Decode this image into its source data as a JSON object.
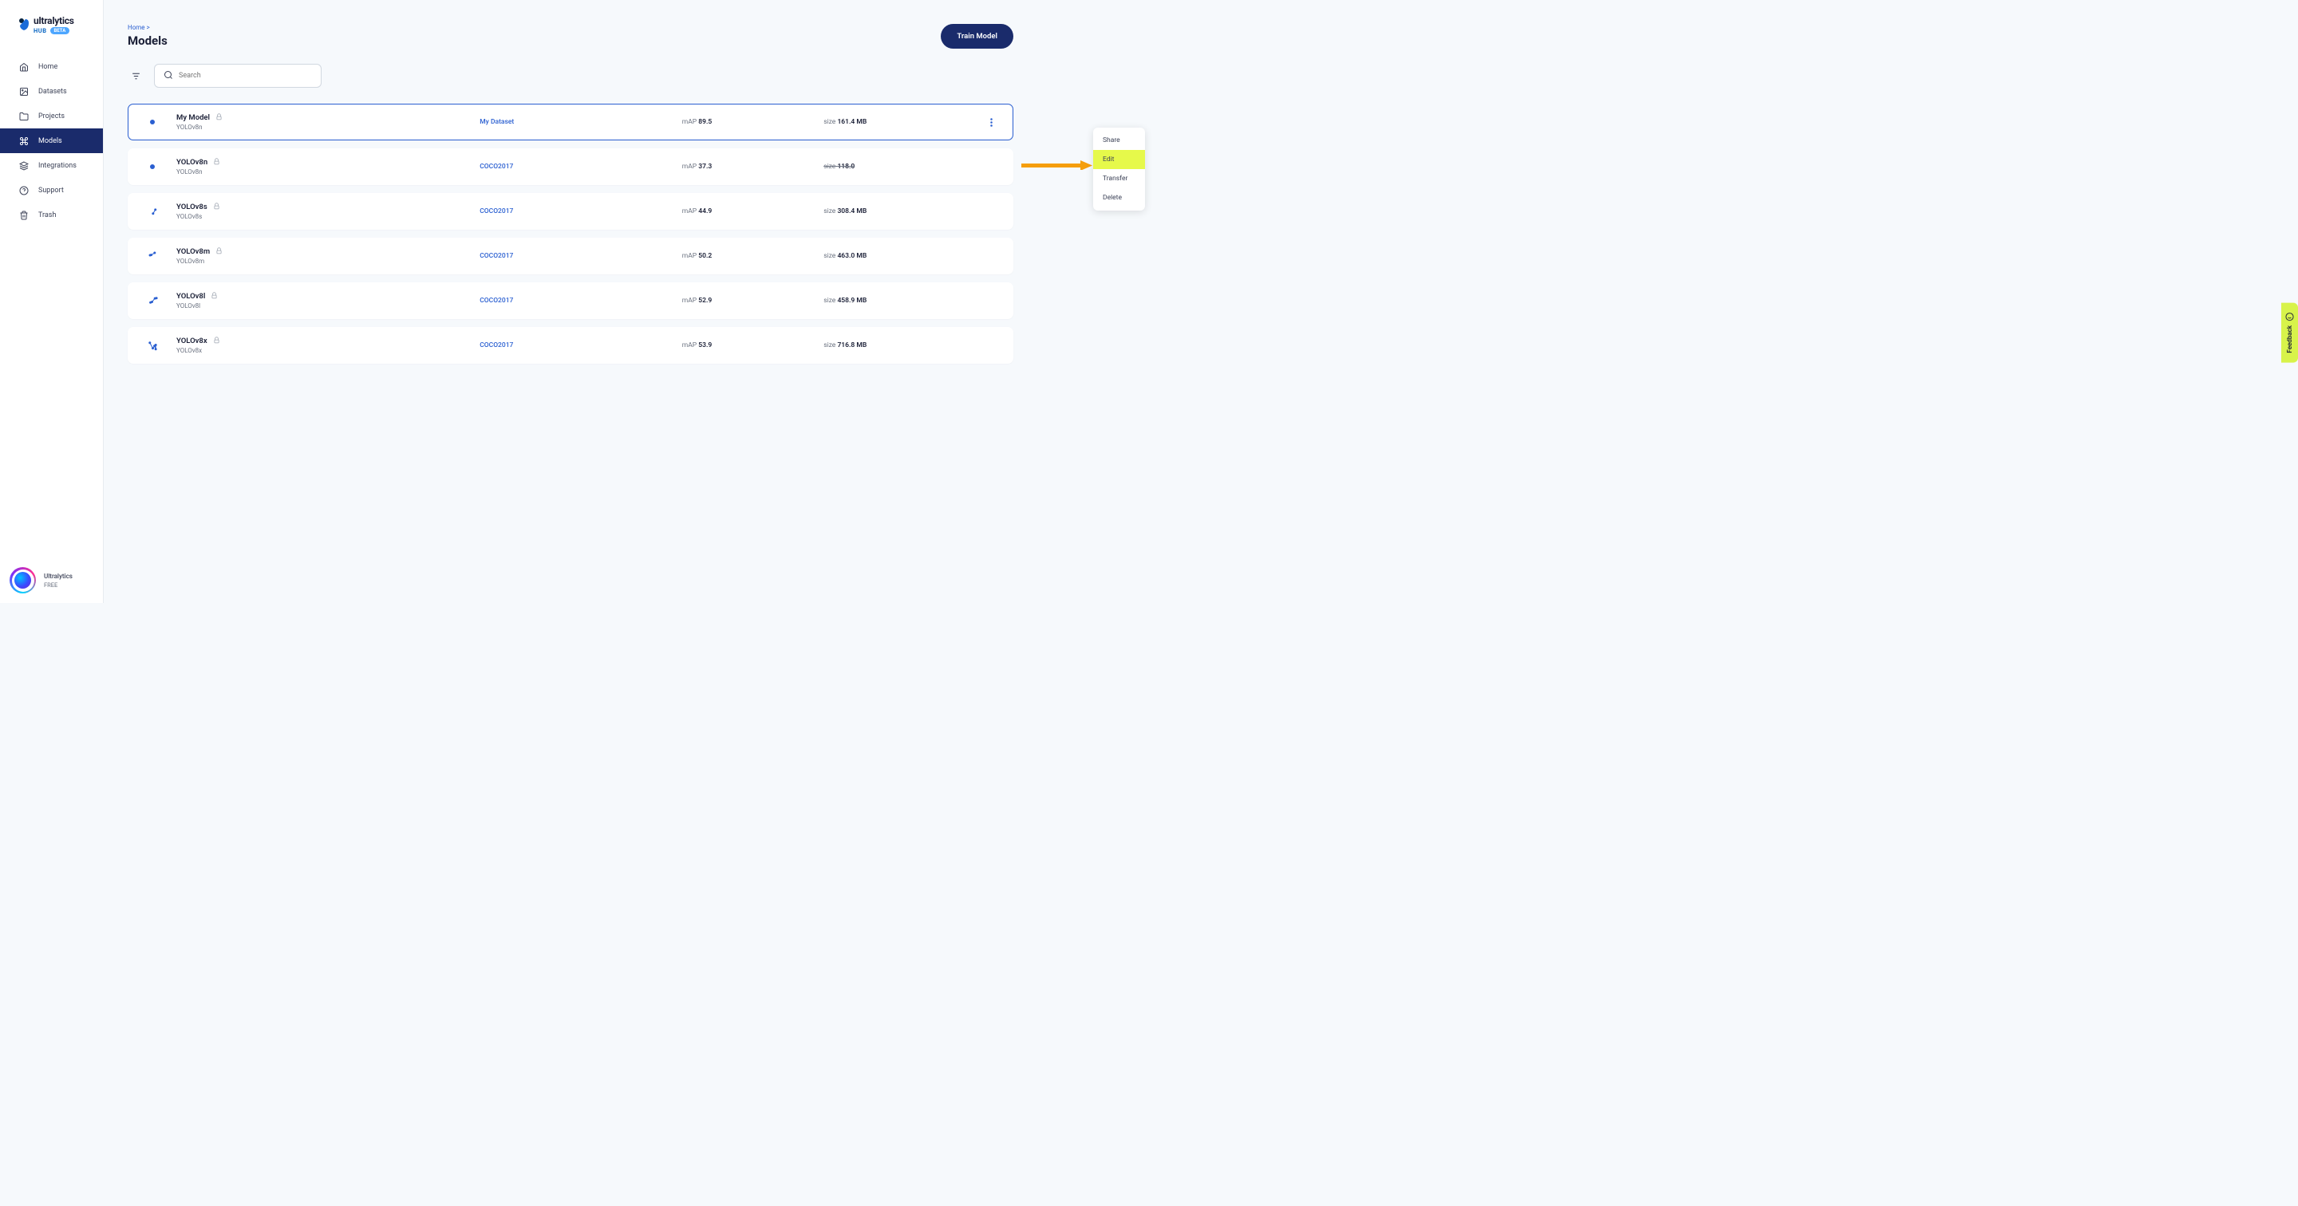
{
  "brand": {
    "name": "ultralytics",
    "sub": "HUB",
    "badge": "BETA"
  },
  "sidebar": {
    "items": [
      {
        "label": "Home"
      },
      {
        "label": "Datasets"
      },
      {
        "label": "Projects"
      },
      {
        "label": "Models"
      },
      {
        "label": "Integrations"
      },
      {
        "label": "Support"
      },
      {
        "label": "Trash"
      }
    ]
  },
  "user": {
    "name": "Ultralytics",
    "plan": "FREE"
  },
  "breadcrumb": {
    "home": "Home",
    "sep": ">"
  },
  "page": {
    "title": "Models",
    "train_button": "Train Model"
  },
  "search": {
    "placeholder": "Search"
  },
  "models": [
    {
      "name": "My Model",
      "arch": "YOLOv8n",
      "dataset": "My Dataset",
      "map_label": "mAP",
      "map": "89.5",
      "size_label": "size",
      "size": "161.4 MB",
      "selected": true,
      "icon": "dot"
    },
    {
      "name": "YOLOv8n",
      "arch": "YOLOv8n",
      "dataset": "COCO2017",
      "map_label": "mAP",
      "map": "37.3",
      "size_label": "size",
      "size": "118.0",
      "selected": false,
      "icon": "dot"
    },
    {
      "name": "YOLOv8s",
      "arch": "YOLOv8s",
      "dataset": "COCO2017",
      "map_label": "mAP",
      "map": "44.9",
      "size_label": "size",
      "size": "308.4 MB",
      "selected": false,
      "icon": "conn1"
    },
    {
      "name": "YOLOv8m",
      "arch": "YOLOv8m",
      "dataset": "COCO2017",
      "map_label": "mAP",
      "map": "50.2",
      "size_label": "size",
      "size": "463.0 MB",
      "selected": false,
      "icon": "conn2"
    },
    {
      "name": "YOLOv8l",
      "arch": "YOLOv8l",
      "dataset": "COCO2017",
      "map_label": "mAP",
      "map": "52.9",
      "size_label": "size",
      "size": "458.9 MB",
      "selected": false,
      "icon": "conn3"
    },
    {
      "name": "YOLOv8x",
      "arch": "YOLOv8x",
      "dataset": "COCO2017",
      "map_label": "mAP",
      "map": "53.9",
      "size_label": "size",
      "size": "716.8 MB",
      "selected": false,
      "icon": "conn4"
    }
  ],
  "context_menu": {
    "items": [
      {
        "label": "Share",
        "highlighted": false
      },
      {
        "label": "Edit",
        "highlighted": true
      },
      {
        "label": "Transfer",
        "highlighted": false
      },
      {
        "label": "Delete",
        "highlighted": false
      }
    ]
  },
  "feedback": {
    "label": "Feedback"
  }
}
